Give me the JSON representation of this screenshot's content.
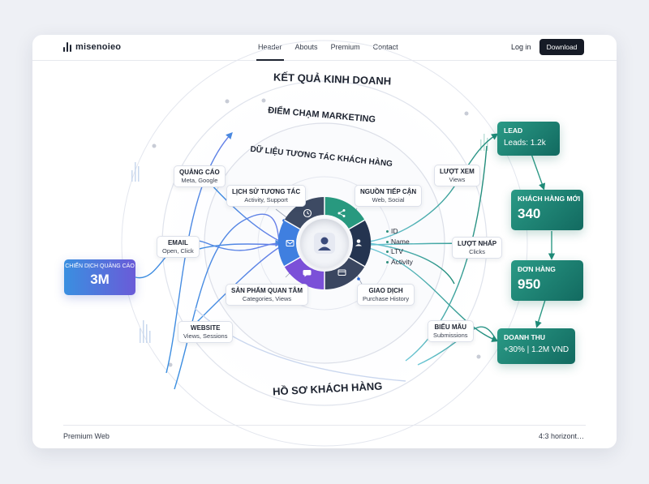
{
  "header": {
    "logo_text": "misenoieo",
    "nav": [
      "Header",
      "Abouts",
      "Premium",
      "Contact"
    ],
    "login": "Log in",
    "download": "Download"
  },
  "rings": {
    "outer": "KẾT QUẢ KINH DOANH",
    "middle": "ĐIỂM CHẠM MARKETING",
    "inner": "DỮ LIỆU TƯƠNG TÁC KHÁCH HÀNG",
    "bottom": "HỒ SƠ KHÁCH HÀNG"
  },
  "touchpoints": {
    "ads": {
      "title": "QUẢNG CÁO",
      "sub": "Meta, Google"
    },
    "email": {
      "title": "EMAIL",
      "sub": "Open, Click"
    },
    "website": {
      "title": "WEBSITE",
      "sub": "Views, Sessions"
    },
    "views": {
      "title": "LƯỢT XEM",
      "sub": "Views"
    },
    "clicks": {
      "title": "LƯỢT NHẤP",
      "sub": "Clicks"
    },
    "forms": {
      "title": "BIỂU MẪU",
      "sub": "Submissions"
    }
  },
  "data_nodes": {
    "history": {
      "title": "LỊCH SỬ TƯƠNG TÁC",
      "sub": "Activity, Support"
    },
    "source": {
      "title": "NGUỒN TIẾP CẬN",
      "sub": "Web, Social"
    },
    "interest": {
      "title": "SẢN PHẨM QUAN TÂM",
      "sub": "Categories, Views"
    },
    "transaction": {
      "title": "GIAO DỊCH",
      "sub": "Purchase History"
    }
  },
  "attributes": [
    "ID",
    "Name",
    "LTV",
    "Activity"
  ],
  "campaign": {
    "title": "CHIẾN DỊCH QUẢNG CÁO",
    "value": "3M"
  },
  "kpis": {
    "lead": {
      "title": "LEAD",
      "value": "Leads: 1.2k"
    },
    "customers": {
      "title": "KHÁCH HÀNG MỚI",
      "value": "340"
    },
    "orders": {
      "title": "ĐƠN HÀNG",
      "value": "950"
    },
    "revenue": {
      "title": "DOANH THU",
      "value": "+30% | 1.2M VND"
    }
  },
  "footer": {
    "left": "Premium Web",
    "right": "4:3 horizont…"
  },
  "colors": {
    "blue": "#3a8fe0",
    "purple": "#6a5bd8",
    "teal": "#1f8b78",
    "dark": "#161b26"
  },
  "icons": [
    "clock-icon",
    "share-icon",
    "user-icon",
    "mail-icon",
    "card-icon",
    "chat-icon"
  ]
}
